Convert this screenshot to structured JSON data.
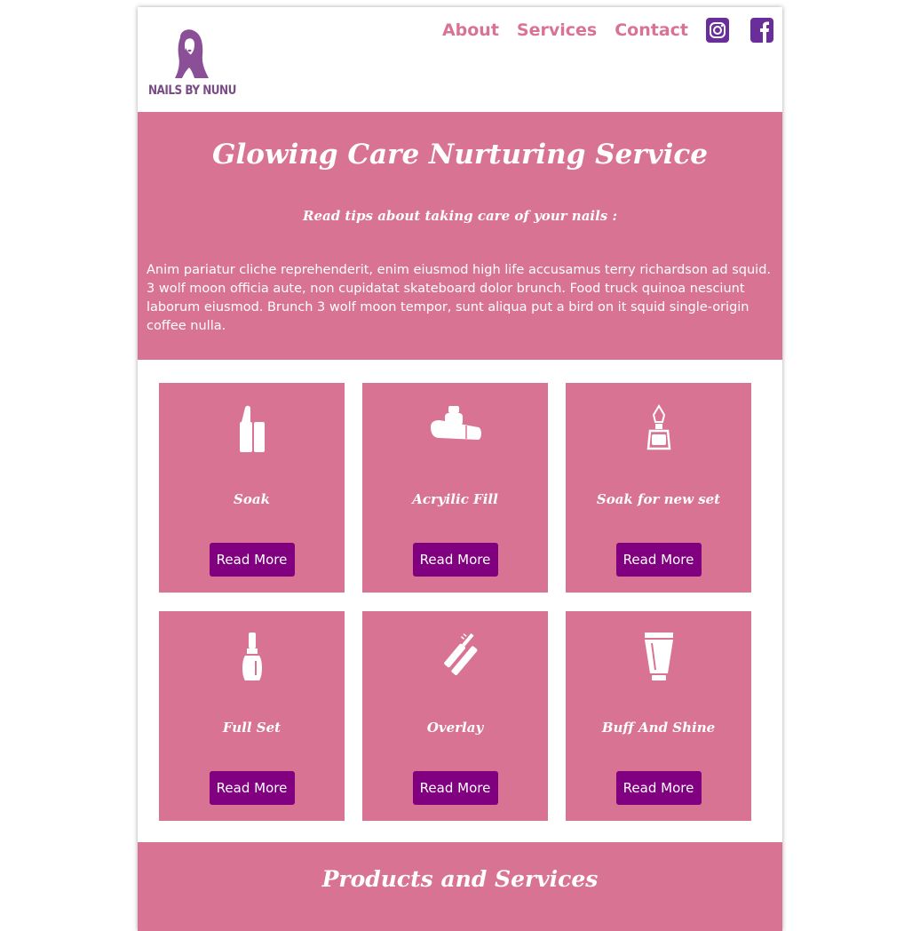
{
  "brand": {
    "name": "NAILS BY NUNU",
    "logo_icon": "woman-face-logo",
    "colors": {
      "pink": "#d97394",
      "purple": "#800080",
      "logo": "#7a4c86"
    }
  },
  "nav": {
    "links": [
      "About",
      "Services",
      "Contact"
    ],
    "social": [
      "instagram-icon",
      "facebook-icon"
    ]
  },
  "hero": {
    "title": "Glowing Care Nurturing Service",
    "subtitle": "Read tips about taking care of your nails :",
    "body": "Anim pariatur cliche reprehenderit, enim eiusmod high life accusamus terry richardson ad squid. 3 wolf moon officia aute, non cupidatat skateboard dolor brunch. Food truck quinoa nesciunt laborum eiusmod. Brunch 3 wolf moon tempor, sunt aliqua put a bird on it squid single-origin coffee nulla."
  },
  "services": [
    {
      "title": "Soak",
      "icon": "lipstick-icon",
      "button": "Read More"
    },
    {
      "title": "Acryilic Fill",
      "icon": "lotion-tube-icon",
      "button": "Read More"
    },
    {
      "title": "Soak for new set",
      "icon": "perfume-bottle-icon",
      "button": "Read More"
    },
    {
      "title": "Full Set",
      "icon": "nail-polish-icon",
      "button": "Read More"
    },
    {
      "title": "Overlay",
      "icon": "mascara-icon",
      "button": "Read More"
    },
    {
      "title": "Buff And Shine",
      "icon": "cream-tube-icon",
      "button": "Read More"
    }
  ],
  "products": {
    "title": "Products and Services"
  }
}
